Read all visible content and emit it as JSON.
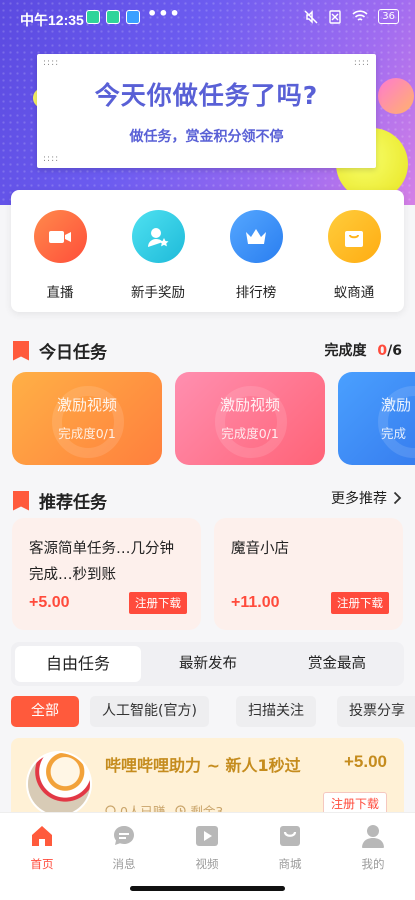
{
  "status_bar": {
    "time": "中午12:35",
    "dots": "•••",
    "battery": "36"
  },
  "banner": {
    "title": "今天你做任务了吗?",
    "subtitle": "做任务，赏金积分领不停",
    "colors": {
      "gradient_start": "#5b4ae0",
      "gradient_end": "#d580e6",
      "text": "#5960d6"
    }
  },
  "quick_entries": [
    {
      "label": "直播",
      "icon": "video-camera-icon",
      "color": "#ff5d3d"
    },
    {
      "label": "新手奖励",
      "icon": "user-star-icon",
      "color": "#22c9e6"
    },
    {
      "label": "排行榜",
      "icon": "crown-icon",
      "color": "#2f8cf0"
    },
    {
      "label": "蚁商通",
      "icon": "shopping-bag-icon",
      "color": "#ffb51c"
    }
  ],
  "today_tasks": {
    "title": "今日任务",
    "progress_label": "完成度",
    "progress_done": "0",
    "progress_total": "/6",
    "cards": [
      {
        "title": "激励视频",
        "progress": "完成度0/1",
        "color_from": "#ffa23a",
        "color_to": "#ff7a3a"
      },
      {
        "title": "激励视频",
        "progress": "完成度0/1",
        "color_from": "#ff7fa6",
        "color_to": "#ff6478"
      },
      {
        "title": "激励",
        "progress": "完成",
        "color_from": "#3a8df5",
        "color_to": "#2f6fe8"
      }
    ]
  },
  "recommend": {
    "title": "推荐任务",
    "more": "更多推荐",
    "cards": [
      {
        "name": "客源简单任务…几分钟完成…秒到账",
        "price": "+5.00",
        "button": "注册下载"
      },
      {
        "name": "魔音小店",
        "price": "+11.00",
        "button": "注册下载"
      }
    ]
  },
  "tabs": [
    {
      "label": "自由任务",
      "active": true
    },
    {
      "label": "最新发布",
      "active": false
    },
    {
      "label": "赏金最高",
      "active": false
    }
  ],
  "filters": [
    {
      "label": "全部",
      "active": true
    },
    {
      "label": "人工智能(官方)",
      "active": false
    },
    {
      "label": "扫描关注",
      "active": false
    },
    {
      "label": "投票分享",
      "active": false
    }
  ],
  "task_item": {
    "title": "哔哩哔哩助力 ~ 新人1秒过",
    "price": "+5.00",
    "earned": "0人已赚",
    "remaining": "剩余3",
    "button": "注册下载"
  },
  "nav": [
    {
      "label": "首页",
      "icon": "home-icon",
      "active": true
    },
    {
      "label": "消息",
      "icon": "message-icon",
      "active": false
    },
    {
      "label": "视频",
      "icon": "play-icon",
      "active": false
    },
    {
      "label": "商城",
      "icon": "shop-bag-icon",
      "active": false
    },
    {
      "label": "我的",
      "icon": "person-icon",
      "active": false
    }
  ],
  "accent_color": "#ff4b3c"
}
